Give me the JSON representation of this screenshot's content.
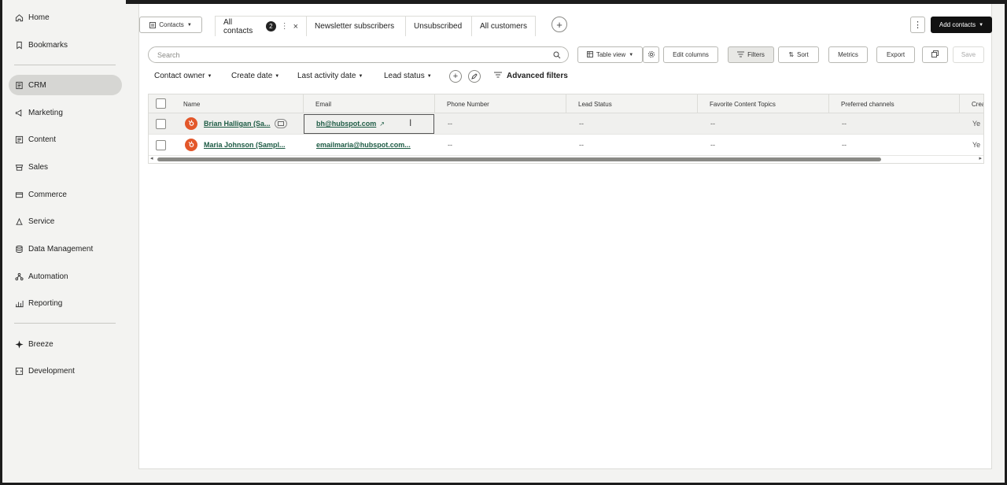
{
  "sidebar": {
    "items": [
      {
        "label": "Home",
        "icon": "home-icon"
      },
      {
        "label": "Bookmarks",
        "icon": "bookmark-icon"
      },
      {
        "label": "CRM",
        "icon": "crm-icon",
        "active": true
      },
      {
        "label": "Marketing",
        "icon": "megaphone-icon"
      },
      {
        "label": "Content",
        "icon": "content-icon"
      },
      {
        "label": "Sales",
        "icon": "sales-icon"
      },
      {
        "label": "Commerce",
        "icon": "commerce-icon"
      },
      {
        "label": "Service",
        "icon": "service-icon"
      },
      {
        "label": "Data Management",
        "icon": "database-icon"
      },
      {
        "label": "Automation",
        "icon": "automation-icon"
      },
      {
        "label": "Reporting",
        "icon": "reporting-icon"
      },
      {
        "label": "Breeze",
        "icon": "sparkle-icon"
      },
      {
        "label": "Development",
        "icon": "development-icon"
      }
    ]
  },
  "header": {
    "object_selector": "Contacts",
    "tabs": [
      {
        "label": "All contacts",
        "count": "2"
      },
      {
        "label": "Newsletter subscribers"
      },
      {
        "label": "Unsubscribed"
      },
      {
        "label": "All customers"
      }
    ],
    "add_contacts": "Add contacts"
  },
  "toolbar": {
    "search_placeholder": "Search",
    "table_view": "Table view",
    "edit_columns": "Edit columns",
    "filters": "Filters",
    "sort": "Sort",
    "metrics": "Metrics",
    "export": "Export",
    "save": "Save"
  },
  "filters": {
    "contact_owner": "Contact owner",
    "create_date": "Create date",
    "last_activity_date": "Last activity date",
    "lead_status": "Lead status",
    "advanced_filters": "Advanced filters"
  },
  "table": {
    "columns": [
      "Name",
      "Email",
      "Phone Number",
      "Lead Status",
      "Favorite Content Topics",
      "Preferred channels",
      "Crea"
    ],
    "rows": [
      {
        "name": "Brian Halligan (Sa...",
        "email": "bh@hubspot.com",
        "phone": "--",
        "lead_status": "--",
        "topics": "--",
        "channels": "--",
        "created": "Ye"
      },
      {
        "name": "Maria Johnson (Sampl...",
        "email": "emailmaria@hubspot.com...",
        "phone": "--",
        "lead_status": "--",
        "topics": "--",
        "channels": "--",
        "created": "Ye"
      }
    ]
  },
  "colors": {
    "accent_link": "#1d5b44",
    "avatar": "#e3572a",
    "sidebar_bg": "#f3f3f1"
  }
}
